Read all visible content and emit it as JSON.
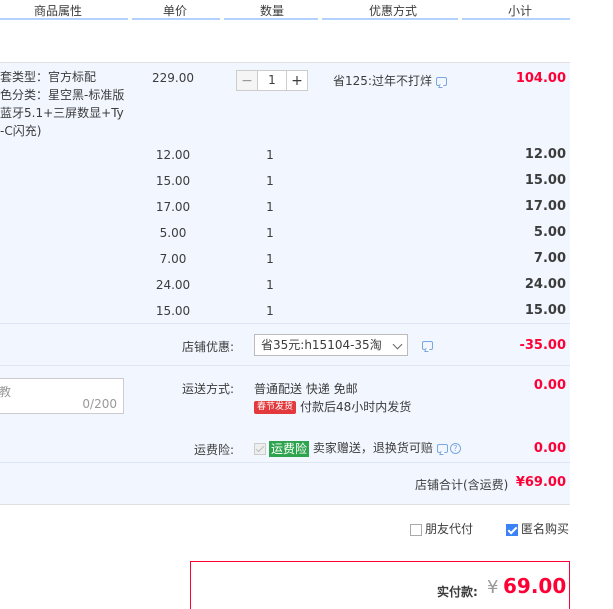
{
  "header": {
    "col_attr": "商品属性",
    "col_price": "单价",
    "col_qty": "数量",
    "col_promo": "优惠方式",
    "col_subtotal": "小计"
  },
  "main_item": {
    "attr_lines": [
      "套类型：官方标配",
      "色分类：星空黑-标准版",
      "蓝牙5.1+三屏数显+Ty",
      "-C闪充)"
    ],
    "price": "229.00",
    "quantity": "1",
    "promo": "省125:过年不打烊",
    "subtotal": "104.00"
  },
  "items": [
    {
      "price": "12.00",
      "qty": "1",
      "subtotal": "12.00"
    },
    {
      "price": "15.00",
      "qty": "1",
      "subtotal": "15.00"
    },
    {
      "price": "17.00",
      "qty": "1",
      "subtotal": "17.00"
    },
    {
      "price": "5.00",
      "qty": "1",
      "subtotal": "5.00"
    },
    {
      "price": "7.00",
      "qty": "1",
      "subtotal": "7.00"
    },
    {
      "price": "24.00",
      "qty": "1",
      "subtotal": "24.00"
    },
    {
      "price": "15.00",
      "qty": "1",
      "subtotal": "15.00"
    }
  ],
  "shop_discount": {
    "label": "店铺优惠:",
    "selected": "省35元:h15104-35淘",
    "amount": "-35.00"
  },
  "message": {
    "placeholder": "教",
    "counter": "0/200"
  },
  "shipping": {
    "label": "运送方式:",
    "method": "普通配送 快递 免邮",
    "badge": "春节发货",
    "note": "付款后48小时内发货",
    "amount": "0.00"
  },
  "insurance": {
    "label": "运费险:",
    "tag": "运费险",
    "desc": "卖家赠送，退换货可赔",
    "amount": "0.00"
  },
  "shop_total": {
    "label": "店铺合计(含运费)",
    "amount": "¥69.00"
  },
  "options": {
    "friend_pay": "朋友代付",
    "anonymous": "匿名购买"
  },
  "payment": {
    "label": "实付款:",
    "currency": "¥",
    "amount": "69.00"
  },
  "colors": {
    "accent_red": "#ff0036",
    "panel_bg": "#f2f7ff",
    "header_line": "#b2d1ff"
  }
}
